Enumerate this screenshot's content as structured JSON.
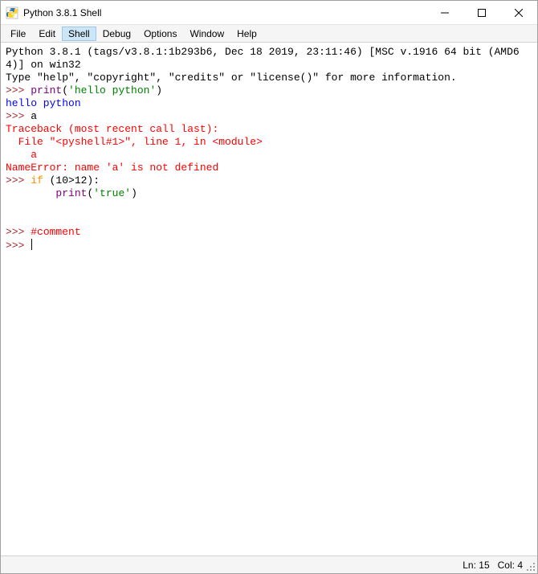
{
  "window": {
    "title": "Python 3.8.1 Shell"
  },
  "menu": {
    "items": [
      "File",
      "Edit",
      "Shell",
      "Debug",
      "Options",
      "Window",
      "Help"
    ],
    "active": "Shell"
  },
  "shell": {
    "banner_line1": "Python 3.8.1 (tags/v3.8.1:1b293b6, Dec 18 2019, 23:11:46) [MSC v.1916 64 bit (AMD64)] on win32",
    "banner_line2": "Type \"help\", \"copyright\", \"credits\" or \"license()\" for more information.",
    "prompt": ">>> ",
    "cont_prompt": "        ",
    "line1_print": "print",
    "line1_open": "(",
    "line1_str": "'hello python'",
    "line1_close": ")",
    "out1": "hello python",
    "line2_code": "a",
    "err1": "Traceback (most recent call last):",
    "err2": "  File \"<pyshell#1>\", line 1, in <module>",
    "err3": "    a",
    "err4": "NameError: name 'a' is not defined",
    "line3_if": "if",
    "line3_cond": " (10>12):",
    "line3b_print": "print",
    "line3b_open": "(",
    "line3b_str": "'true'",
    "line3b_close": ")",
    "line4_comment": "#comment"
  },
  "status": {
    "ln_label": "Ln:",
    "ln_val": "15",
    "col_label": "Col:",
    "col_val": "4"
  }
}
